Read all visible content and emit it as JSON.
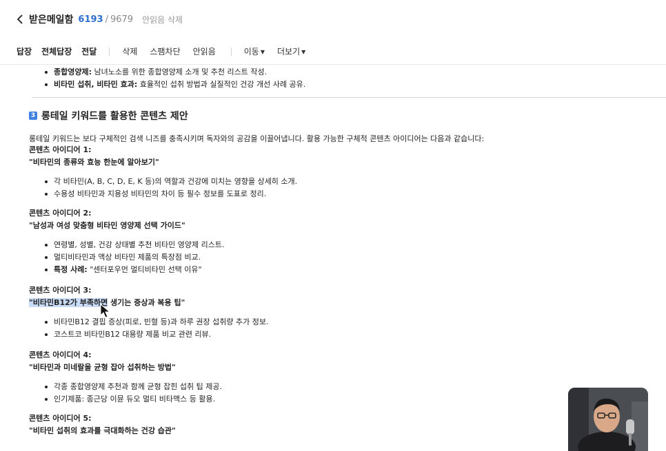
{
  "header": {
    "title": "받은메일함",
    "count_unread": "6193",
    "count_separator": "/",
    "count_total": "9679",
    "delete_unread": "안읽음 삭제"
  },
  "toolbar": {
    "reply": "답장",
    "reply_all": "전체답장",
    "forward": "전달",
    "delete": "삭제",
    "block_spam": "스팸차단",
    "mark_unread": "안읽음",
    "move": "이동",
    "more": "더보기"
  },
  "top_bullets": [
    {
      "bold": "종합영양제:",
      "text": " 남녀노소를 위한 종합영양제 소개 및 추천 리스트 작성."
    },
    {
      "bold": "비타민 섭취, 비타민 효과:",
      "text": " 효율적인 섭취 방법과 실질적인 건강 개선 사례 공유."
    }
  ],
  "section": {
    "number": "3",
    "title": "롱테일 키워드를 활용한 콘텐츠 제안",
    "intro": "롱테일 키워드는 보다 구체적인 검색 니즈를 충족시키며 독자와의 공감을 이끌어냅니다. 활용 가능한 구체적 콘텐츠 아이디어는 다음과 같습니다:"
  },
  "ideas": [
    {
      "label": "콘텐츠 아이디어 1:",
      "title": "\"비타민의 종류와 효능 한눈에 알아보기\"",
      "bullets": [
        "각 비타민(A, B, C, D, E, K 등)의 역할과 건강에 미치는 영향을 상세히 소개.",
        "수용성 비타민과 지용성 비타민의 차이 등 필수 정보를 도표로 정리."
      ]
    },
    {
      "label": "콘텐츠 아이디어 2:",
      "title": "\"남성과 여성 맞춤형 비타민 영양제 선택 가이드\"",
      "bullets": [
        "연령별, 성별, 건강 상태별 추천 비타민 영양제 리스트.",
        "멀티비타민과 액상 비타민 제품의 특장점 비교."
      ],
      "bold_bullet": {
        "bold": "특정 사례:",
        "text": " \"센터포우먼 멀티비타민 선택 이유\""
      }
    },
    {
      "label": "콘텐츠 아이디어 3:",
      "title_highlight": "\"비타민B12가 부족하면",
      "title_rest": " 생기는 증상과 복용 팁\"",
      "bullets": [
        "비타민B12 결핍 증상(피로, 빈혈 등)과 하루 권장 섭취량 추가 정보.",
        "코스트코 비타민B12 대용량 제품 비교 관련 리뷰."
      ]
    },
    {
      "label": "콘텐츠 아이디어 4:",
      "title": "\"비타민과 미네랄을 균형 잡아 섭취하는 방법\"",
      "bullets": [
        "각종 종합영양제 추천과 함께 균형 잡힌 섭취 팁 제공.",
        "인기제품: 종근당 이뮨 듀오 멀티 비타맥스 등 활용."
      ]
    },
    {
      "label": "콘텐츠 아이디어 5:",
      "title": "\"비타민 섭취의 효과를 극대화하는 건강 습관\""
    }
  ]
}
